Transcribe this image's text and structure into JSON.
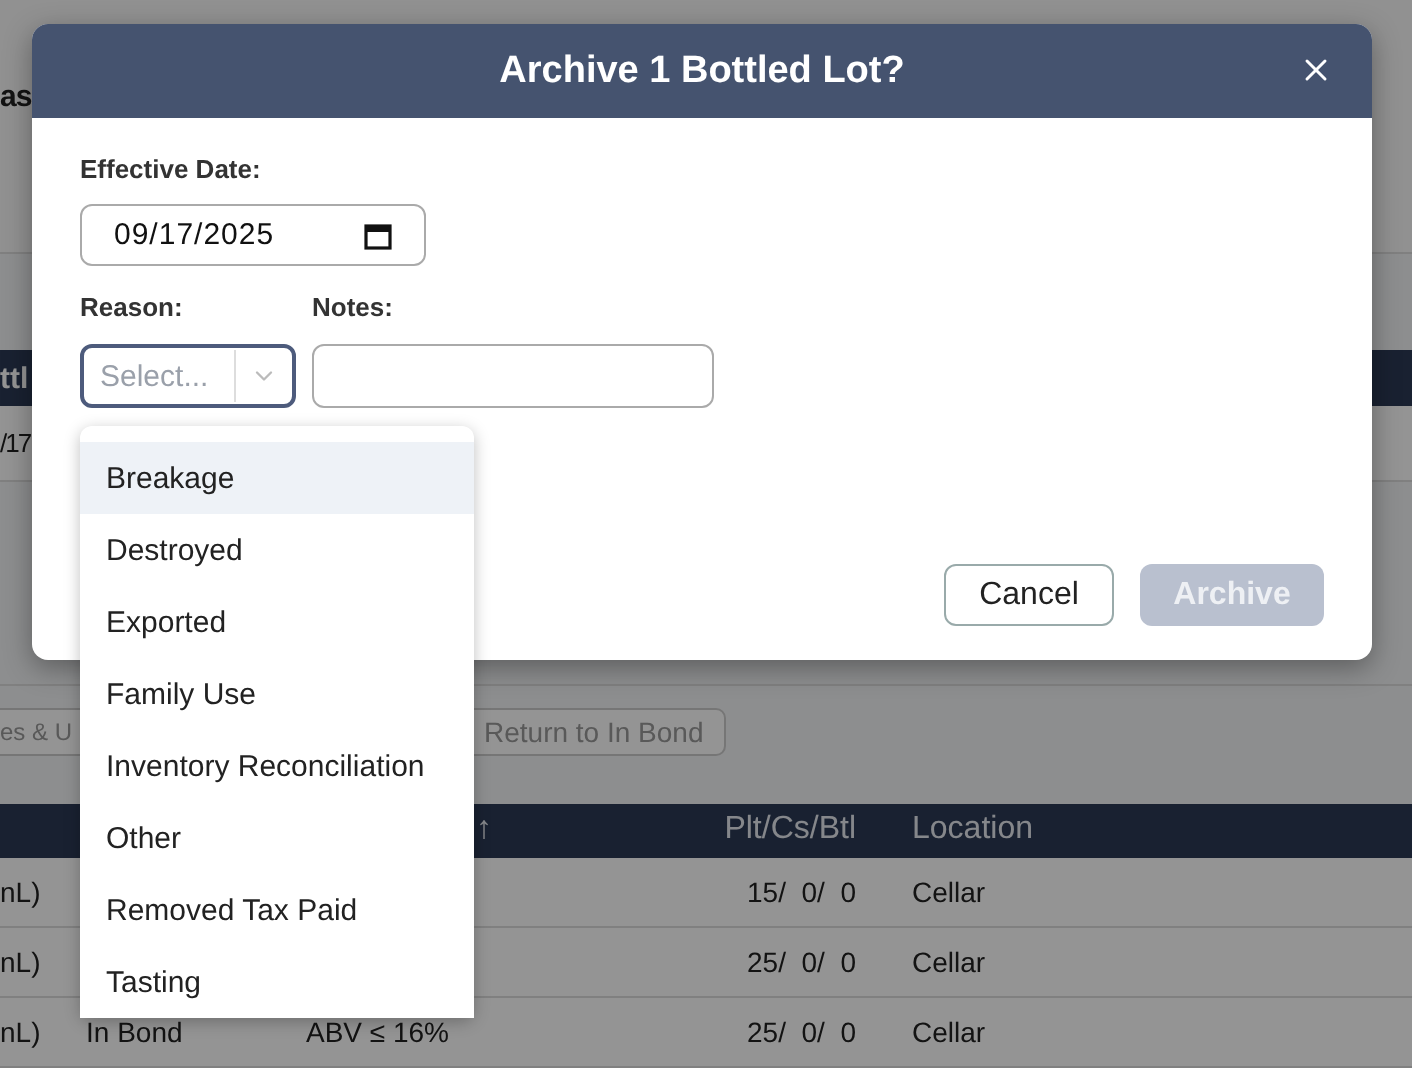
{
  "background": {
    "page_title": "as",
    "list_header": "ttl",
    "list_row": "/17",
    "toolbar_buttons": [
      {
        "label": "es & U"
      },
      {
        "label": "Return to In Bond"
      }
    ],
    "table": {
      "header": {
        "column_3": "↑",
        "column_4": "Plt/Cs/Btl",
        "column_5": "Location"
      },
      "rows": [
        {
          "column_1": "nL)",
          "column_4": "15/  0/  0",
          "column_5": "Cellar"
        },
        {
          "column_1": "nL)",
          "column_4": "25/  0/  0",
          "column_5": "Cellar"
        },
        {
          "column_1": "nL)",
          "column_2": "In Bond",
          "column_3": "ABV ≤ 16%",
          "column_4": "25/  0/  0",
          "column_5": "Cellar"
        }
      ]
    }
  },
  "dialog": {
    "title": "Archive 1 Bottled Lot?",
    "effective_date": {
      "label": "Effective Date:",
      "value": "09/17/2025"
    },
    "reason": {
      "label": "Reason:",
      "placeholder": "Select...",
      "open": true
    },
    "notes": {
      "label": "Notes:"
    },
    "buttons": [
      {
        "label": "Cancel",
        "kind": "secondary",
        "disabled": false
      },
      {
        "label": "Archive",
        "kind": "primary",
        "disabled": true
      }
    ]
  },
  "reason_options": [
    {
      "label": "Breakage",
      "selected": true
    },
    {
      "label": "Destroyed",
      "selected": false
    },
    {
      "label": "Exported",
      "selected": false
    },
    {
      "label": "Family Use",
      "selected": false
    },
    {
      "label": "Inventory Reconciliation",
      "selected": false
    },
    {
      "label": "Other",
      "selected": false
    },
    {
      "label": "Removed Tax Paid",
      "selected": false
    },
    {
      "label": "Tasting",
      "selected": false
    }
  ]
}
